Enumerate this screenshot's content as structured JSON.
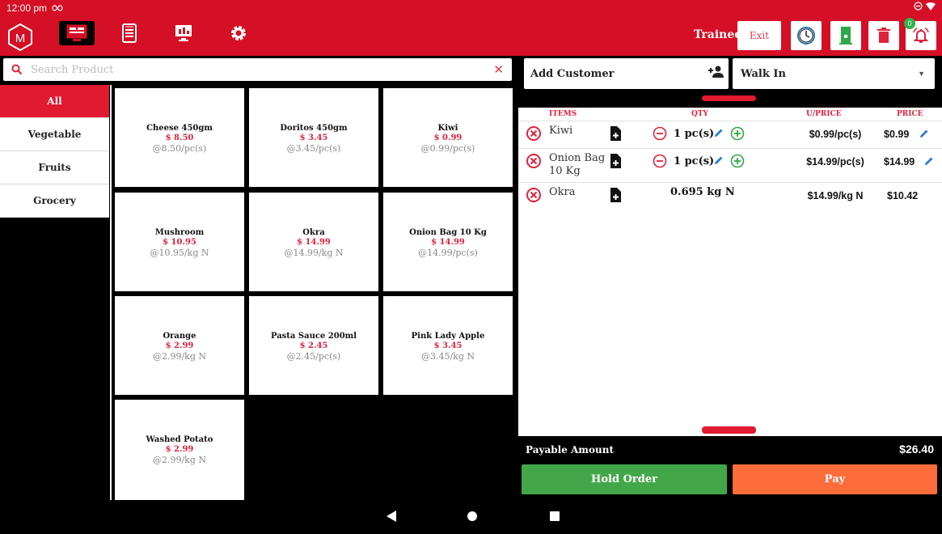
{
  "status_bar": {
    "time": "12:00 pm",
    "icon": "infinity-icon"
  },
  "app_bar": {
    "nav": [
      {
        "icon": "register-icon",
        "active": true
      },
      {
        "icon": "orders-list-icon",
        "active": false
      },
      {
        "icon": "dashboard-icon",
        "active": false
      },
      {
        "icon": "gear-icon",
        "active": false
      }
    ],
    "user_label": "Trainee",
    "exit_label": "Exit",
    "notification_count": "0",
    "colors": {
      "brand": "#d50f25",
      "accent": "#e21a30",
      "hold": "#43a74a",
      "pay": "#fd6c3b"
    }
  },
  "search": {
    "placeholder": "Search Product",
    "value": ""
  },
  "categories": [
    {
      "label": "All",
      "active": true
    },
    {
      "label": "Vegetable",
      "active": false
    },
    {
      "label": "Fruits",
      "active": false
    },
    {
      "label": "Grocery",
      "active": false
    }
  ],
  "products": [
    {
      "name": "Cheese 450gm",
      "price": "$ 8.50",
      "unit": "@8.50/pc(s)"
    },
    {
      "name": "Doritos 450gm",
      "price": "$ 3.45",
      "unit": "@3.45/pc(s)"
    },
    {
      "name": "Kiwi",
      "price": "$ 0.99",
      "unit": "@0.99/pc(s)"
    },
    {
      "name": "Mushroom",
      "price": "$ 10.95",
      "unit": "@10.95/kg N"
    },
    {
      "name": "Okra",
      "price": "$ 14.99",
      "unit": "@14.99/kg N"
    },
    {
      "name": "Onion Bag 10 Kg",
      "price": "$ 14.99",
      "unit": "@14.99/pc(s)"
    },
    {
      "name": "Orange",
      "price": "$ 2.99",
      "unit": "@2.99/kg N"
    },
    {
      "name": "Pasta Sauce 200ml",
      "price": "$ 2.45",
      "unit": "@2.45/pc(s)"
    },
    {
      "name": "Pink Lady Apple",
      "price": "$ 3.45",
      "unit": "@3.45/kg N"
    },
    {
      "name": "Washed Potato",
      "price": "$ 2.99",
      "unit": "@2.99/kg N"
    }
  ],
  "customer": {
    "label": "Add Customer",
    "type": "Walk In"
  },
  "cart": {
    "headers": {
      "items": "ITEMS",
      "qty": "QTY",
      "uprice": "U/PRICE",
      "price": "PRICE"
    },
    "rows": [
      {
        "name": "Kiwi",
        "qty": "1 pc(s)",
        "uprice": "$0.99/pc(s)",
        "price": "$0.99",
        "editable": true
      },
      {
        "name": "Onion Bag 10 Kg",
        "qty": "1 pc(s)",
        "uprice": "$14.99/pc(s)",
        "price": "$14.99",
        "editable": true
      },
      {
        "name": "Okra",
        "qty": "0.695 kg N",
        "uprice": "$14.99/kg N",
        "price": "$10.42",
        "editable": false
      }
    ]
  },
  "totals": {
    "label": "Payable Amount",
    "amount": "$26.40"
  },
  "actions": {
    "hold": "Hold Order",
    "pay": "Pay"
  }
}
